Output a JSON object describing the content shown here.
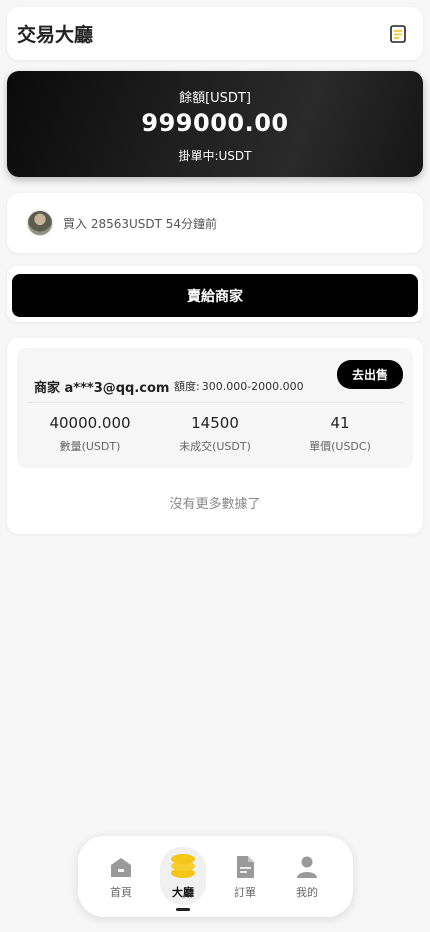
{
  "header": {
    "title": "交易大廳",
    "icon": "note-icon"
  },
  "balance": {
    "label": "餘額[USDT]",
    "amount": "999000.00",
    "pending": "掛單中:USDT"
  },
  "activity": {
    "text": "買入 28563USDT 54分鐘前"
  },
  "sell_button": {
    "label": "賣給商家"
  },
  "listing": {
    "merchant": "商家 a***3@qq.com",
    "quota_label": "額度:",
    "quota_value": "300.000-2000.000",
    "sell_label": "去出售",
    "stats": [
      {
        "value": "40000.000",
        "label": "數量(USDT)"
      },
      {
        "value": "14500",
        "label": "未成交(USDT)"
      },
      {
        "value": "41",
        "label": "單價(USDC)"
      }
    ]
  },
  "no_more": "沒有更多數據了",
  "tabbar": {
    "items": [
      {
        "label": "首頁",
        "icon": "home-icon"
      },
      {
        "label": "大廳",
        "icon": "coins-icon",
        "active": true
      },
      {
        "label": "訂單",
        "icon": "document-icon"
      },
      {
        "label": "我的",
        "icon": "user-icon"
      }
    ]
  },
  "colors": {
    "accent": "#f5c518",
    "primary": "#000000",
    "background": "#f7f7f7"
  }
}
